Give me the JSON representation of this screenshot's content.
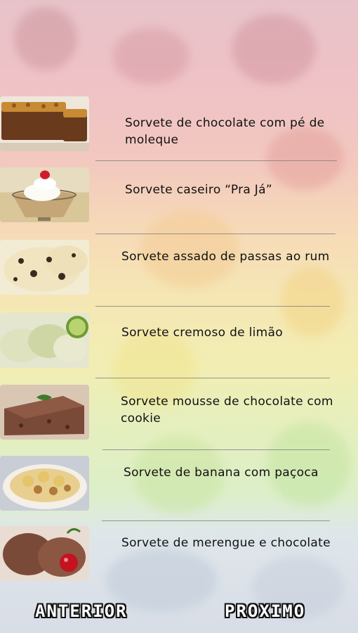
{
  "recipes": [
    {
      "title": "Sorvete de chocolate com pé de moleque",
      "image_icon": "chocolate-loaf-cake"
    },
    {
      "title": "Sorvete caseiro “Pra Já”",
      "image_icon": "ice-cream-cup-cherry"
    },
    {
      "title": "Sorvete assado de passas ao rum",
      "image_icon": "raisin-ice-cream-scoop"
    },
    {
      "title": "Sorvete cremoso de limão",
      "image_icon": "lime-ice-cream-scoops"
    },
    {
      "title": "Sorvete mousse de chocolate com cookie",
      "image_icon": "chocolate-mousse-slice"
    },
    {
      "title": "Sorvete de banana com paçoca",
      "image_icon": "banana-pacoca-bowl"
    },
    {
      "title": "Sorvete de merengue e chocolate",
      "image_icon": "chocolate-scoops-cherry"
    }
  ],
  "nav": {
    "previous_label": "ANTERIOR",
    "next_label": "PROXIMO"
  }
}
